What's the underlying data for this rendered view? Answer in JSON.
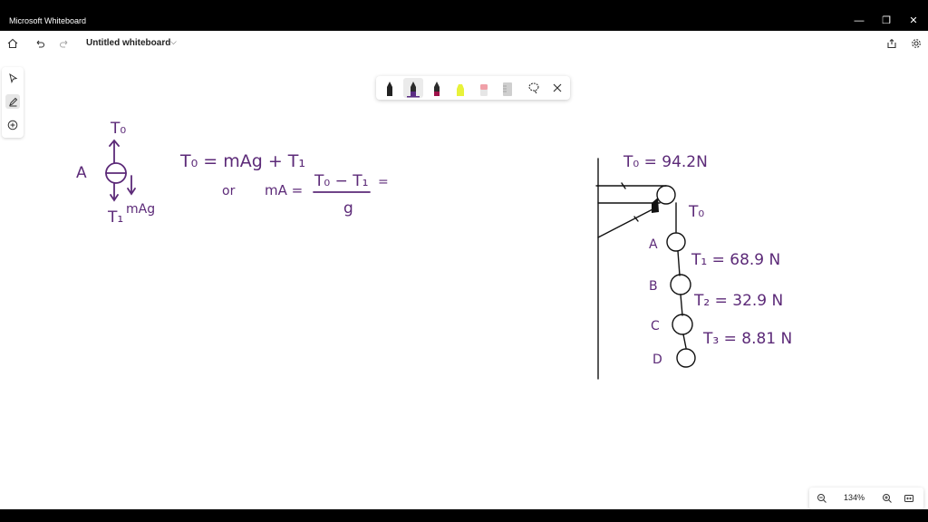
{
  "window": {
    "title": "Microsoft Whiteboard"
  },
  "toolbar": {
    "document_title": "Untitled whiteboard"
  },
  "zoom": {
    "level": "134%"
  },
  "pen_colors": {
    "black": "#222222",
    "purple": "#5b2c83",
    "crimson": "#a0124a",
    "yellow_highlighter": "#e8f23a",
    "eraser": "#f0a0a8",
    "ruler": "#cfcfcf"
  },
  "ink_color": "#5c2a78",
  "board": {
    "left": {
      "T0_top": "T₀",
      "A": "A",
      "T1": "T₁",
      "mAg": "mAg",
      "eq1": "T₀ = mAg + T₁",
      "or": "or",
      "mA": "mA =",
      "numer": "T₀ − T₁",
      "denom": "g",
      "eq_tail": "="
    },
    "right": {
      "T0_value": "T₀ = 94.2N",
      "T0_label": "T₀",
      "A": "A",
      "B": "B",
      "C": "C",
      "D": "D",
      "T1": "T₁ = 68.9 N",
      "T2": "T₂ = 32.9 N",
      "T3": "T₃ = 8.81 N"
    }
  }
}
